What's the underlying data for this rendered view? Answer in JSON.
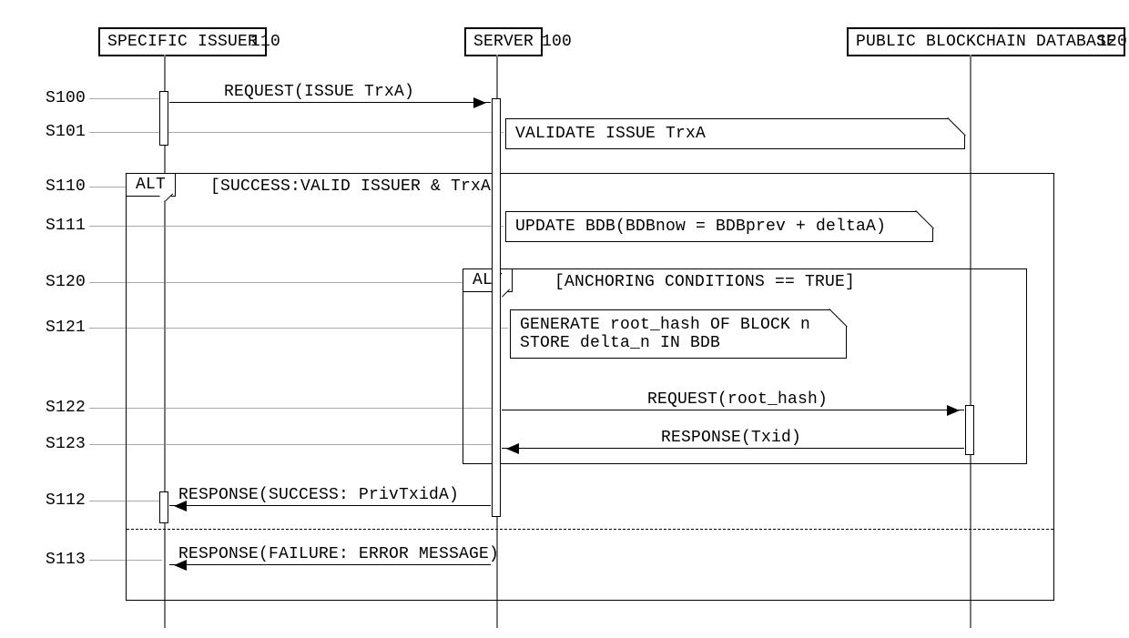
{
  "participants": {
    "issuer": {
      "label": "SPECIFIC ISSUER",
      "ref": "110"
    },
    "server": {
      "label": "SERVER",
      "ref": "100"
    },
    "pbd": {
      "label": "PUBLIC BLOCKCHAIN DATABASE",
      "ref": "120"
    }
  },
  "steps": {
    "s100": "S100",
    "s101": "S101",
    "s110": "S110",
    "s111": "S111",
    "s120": "S120",
    "s121": "S121",
    "s122": "S122",
    "s123": "S123",
    "s112": "S112",
    "s113": "S113"
  },
  "frames": {
    "outer": {
      "label": "ALT",
      "guard": "[SUCCESS:VALID ISSUER & TrxA]"
    },
    "inner": {
      "label": "ALT",
      "guard": "[ANCHORING CONDITIONS == TRUE]"
    }
  },
  "notes": {
    "validate": {
      "l1": "VALIDATE ISSUE TrxA"
    },
    "update": {
      "l1": "UPDATE BDB(BDBnow = BDBprev + deltaA)"
    },
    "generate": {
      "l1": "GENERATE root_hash OF BLOCK n",
      "l2": "STORE delta_n IN BDB"
    }
  },
  "messages": {
    "req_issue": "REQUEST(ISSUE TrxA)",
    "req_root": "REQUEST(root_hash)",
    "resp_txid": "RESPONSE(Txid)",
    "resp_ok": "RESPONSE(SUCCESS: PrivTxidA)",
    "resp_fail": "RESPONSE(FAILURE: ERROR MESSAGE)"
  }
}
